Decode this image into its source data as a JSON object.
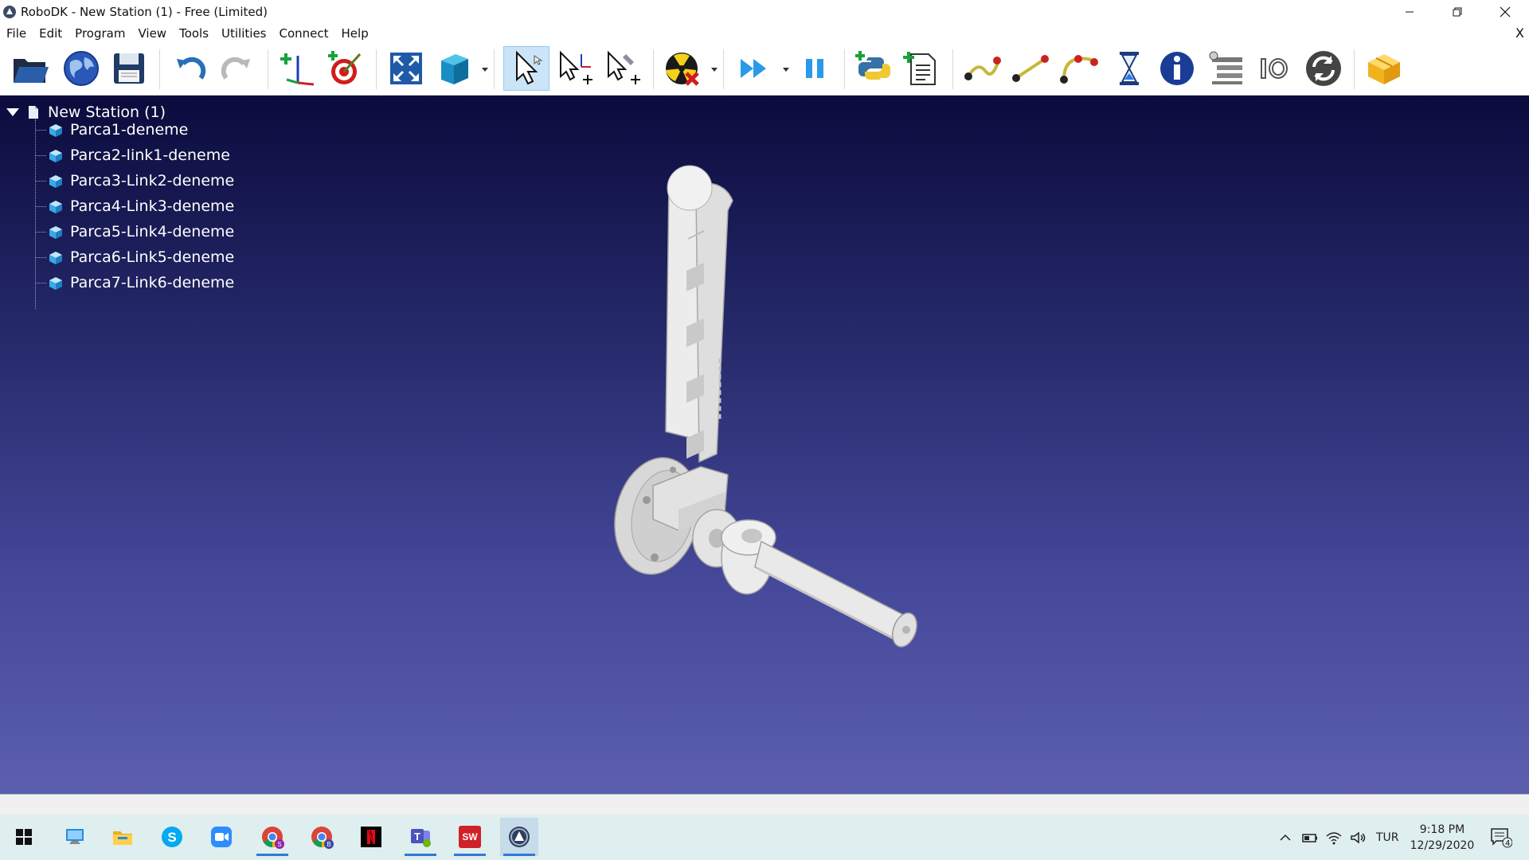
{
  "window": {
    "title": "RoboDK - New Station (1) - Free (Limited)",
    "controls": [
      "minimize-icon",
      "restore-icon",
      "close-icon"
    ]
  },
  "menu": {
    "items": [
      "File",
      "Edit",
      "Program",
      "View",
      "Tools",
      "Utilities",
      "Connect",
      "Help"
    ],
    "close_glyph": "X"
  },
  "toolbar": {
    "buttons": [
      "open-folder-icon",
      "online-library-globe-icon",
      "save-icon",
      "undo-icon",
      "redo-icon",
      "add-reference-frame-icon",
      "add-target-icon",
      "fit-all-icon",
      "view-cube-icon",
      "select-icon",
      "move-reference-icon",
      "move-tool-icon",
      "check-collisions-icon",
      "run-simulation-icon",
      "pause-simulation-icon",
      "add-python-program-icon",
      "add-program-icon",
      "move-joint-icon",
      "move-linear-icon",
      "move-circular-icon",
      "pause-timer-icon",
      "info-icon",
      "program-list-icon",
      "io-icon",
      "reconnect-icon",
      "package-icon"
    ],
    "active": "select-icon"
  },
  "tree": {
    "root": "New Station (1)",
    "items": [
      "Parca1-deneme",
      "Parca2-link1-deneme",
      "Parca3-Link2-deneme",
      "Parca4-Link3-deneme",
      "Parca5-Link4-deneme",
      "Parca6-Link5-deneme",
      "Parca7-Link6-deneme"
    ]
  },
  "colors": {
    "viewport_top": "#0b0b3d",
    "viewport_bottom": "#5b5fae",
    "model": "#e6e6e6",
    "taskbar": "#dfeeee",
    "accent": "#2d7ad6"
  },
  "taskbar": {
    "apps": [
      "windows-start-icon",
      "this-pc-icon",
      "file-explorer-icon",
      "skype-icon",
      "zoom-icon",
      "chrome-profile-s-icon",
      "chrome-profile-b-icon",
      "netflix-icon",
      "teams-icon",
      "solidworks-2017-icon",
      "robodk-icon"
    ],
    "tray": {
      "language": "TUR",
      "time": "9:18 PM",
      "date": "12/29/2020",
      "notification_count": "4"
    }
  }
}
